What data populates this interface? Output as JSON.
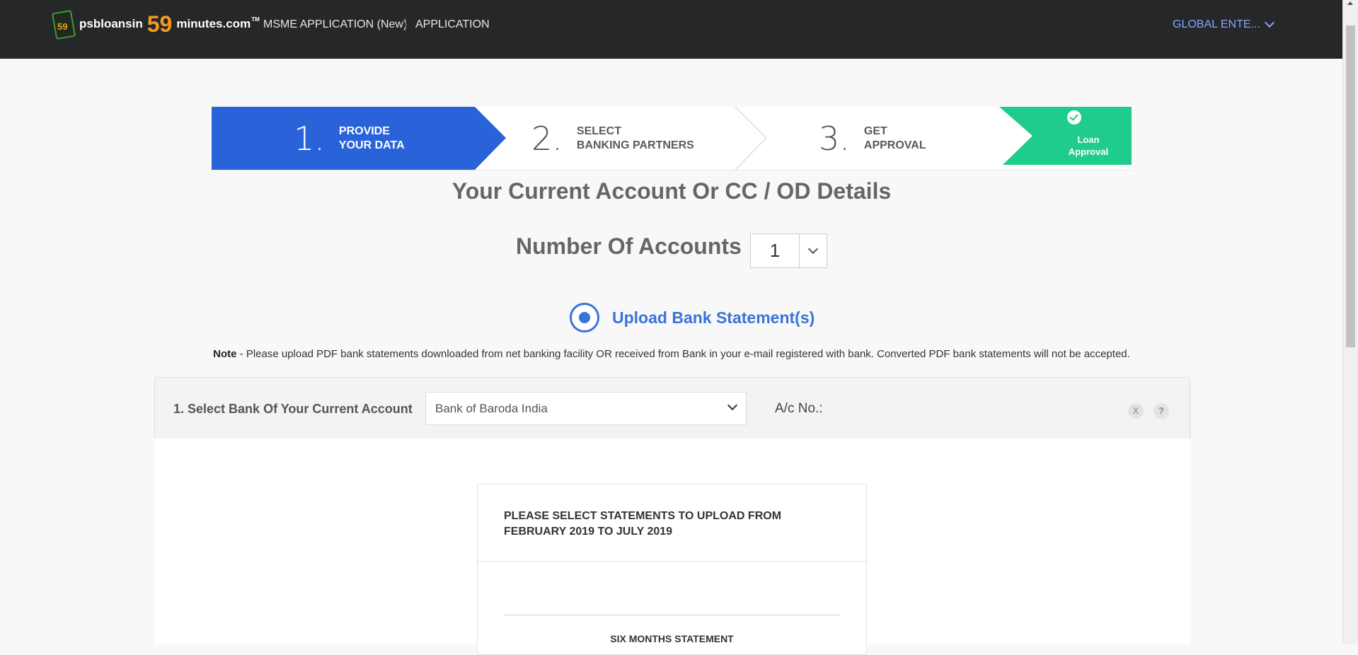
{
  "header": {
    "logo_prefix": "psbloansin",
    "logo_number": "59",
    "logo_suffix": "minutes.com",
    "logo_tm": "TM",
    "badge_number": "59",
    "menu_label": "MSME APPLICATION (New)",
    "application_label": "APPLICATION",
    "user_label": "GLOBAL ENTE..."
  },
  "stepper": {
    "steps": [
      {
        "number": "1.",
        "line1": "PROVIDE",
        "line2": "YOUR DATA"
      },
      {
        "number": "2.",
        "line1": "SELECT",
        "line2": "BANKING PARTNERS"
      },
      {
        "number": "3.",
        "line1": "GET",
        "line2": "APPROVAL"
      }
    ],
    "final": {
      "line1": "Loan",
      "line2": "Approval"
    },
    "colors": {
      "active": "#2a63d9",
      "final": "#20cc8b"
    }
  },
  "section_title": "Your Current Account Or CC / OD Details",
  "accounts": {
    "label": "Number Of Accounts",
    "help": "?",
    "value": "1"
  },
  "upload_option": {
    "label": "Upload Bank Statement(s)",
    "selected": true
  },
  "note": {
    "bold": "Note",
    "text": " - Please upload PDF bank statements downloaded from net banking facility OR received from Bank in your e-mail registered with bank. Converted PDF bank statements will not be accepted."
  },
  "bank_row": {
    "label": "1. Select Bank Of Your Current Account",
    "selected_bank": "Bank of Baroda India",
    "account_label": "A/c No.:",
    "remove": "X",
    "help": "?"
  },
  "statement_card": {
    "heading_line1": "PLEASE SELECT STATEMENTS TO UPLOAD FROM",
    "heading_line2": "FEBRUARY 2019 TO JULY 2019",
    "subheading": "SIX MONTHS STATEMENT"
  }
}
